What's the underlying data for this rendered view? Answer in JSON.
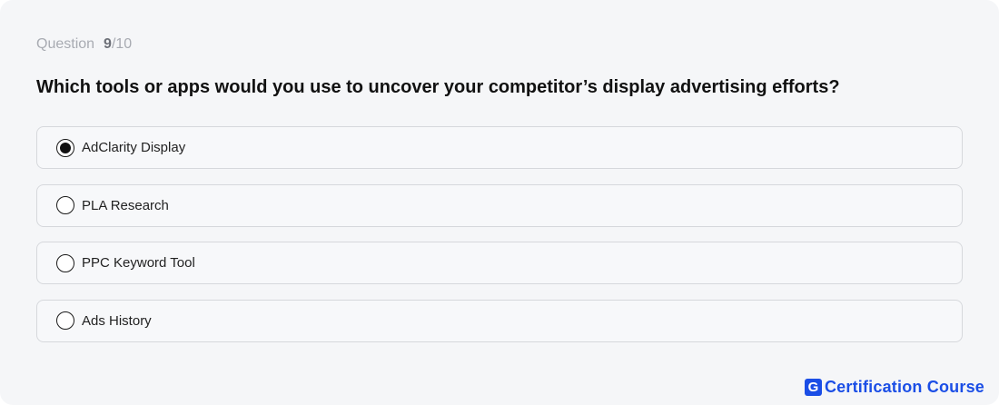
{
  "progress": {
    "label": "Question",
    "current": "9",
    "total": "/10"
  },
  "question": {
    "text": "Which tools or apps would you use to uncover your competitor’s display advertising efforts?"
  },
  "options": [
    {
      "label": "AdClarity Display",
      "selected": true
    },
    {
      "label": "PLA Research",
      "selected": false
    },
    {
      "label": "PPC Keyword Tool",
      "selected": false
    },
    {
      "label": "Ads History",
      "selected": false
    }
  ],
  "brand": {
    "logo_letter": "G",
    "text": "Certification Course",
    "color": "#1b4ee6"
  }
}
